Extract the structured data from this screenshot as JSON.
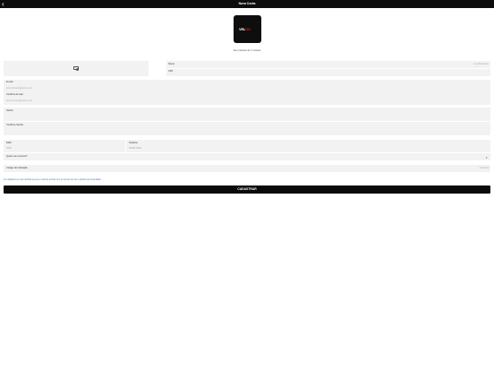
{
  "nav": {
    "title": "Nova Conta",
    "back_icon": "chevron-left-icon"
  },
  "logo": {
    "text_white": "VEL",
    "text_red": "OX"
  },
  "member": "Seu número de 1 minuto",
  "photo": {
    "icon": "camera-icon"
  },
  "fields": {
    "name": {
      "label": "Nome",
      "placeholder": "Luiz Rohmann"
    },
    "cpf": {
      "label": "CPF"
    },
    "email": {
      "label": "E-mail",
      "placeholder": "luiz.rohmann@velox.com"
    },
    "confirm_email": {
      "label": "Confirme E-mail",
      "placeholder": "luiz.rohmann@velox.com"
    },
    "password": {
      "label": "Senha"
    },
    "confirm_password": {
      "label": "Confirme Senha"
    },
    "ddd": {
      "label": "DDD",
      "placeholder": "DDD"
    },
    "phone": {
      "label": "Telefone",
      "placeholder": "99999-9999"
    },
    "how_know": {
      "label": "Qual o seu número?"
    },
    "invite": {
      "label": "Código de Indicação",
      "placeholder": "Opcional"
    }
  },
  "terms": "Ao cadastrar-se você declara que leu e está de acordo com os termos de uso e política de privacidade.",
  "submit": "CADASTRAR"
}
